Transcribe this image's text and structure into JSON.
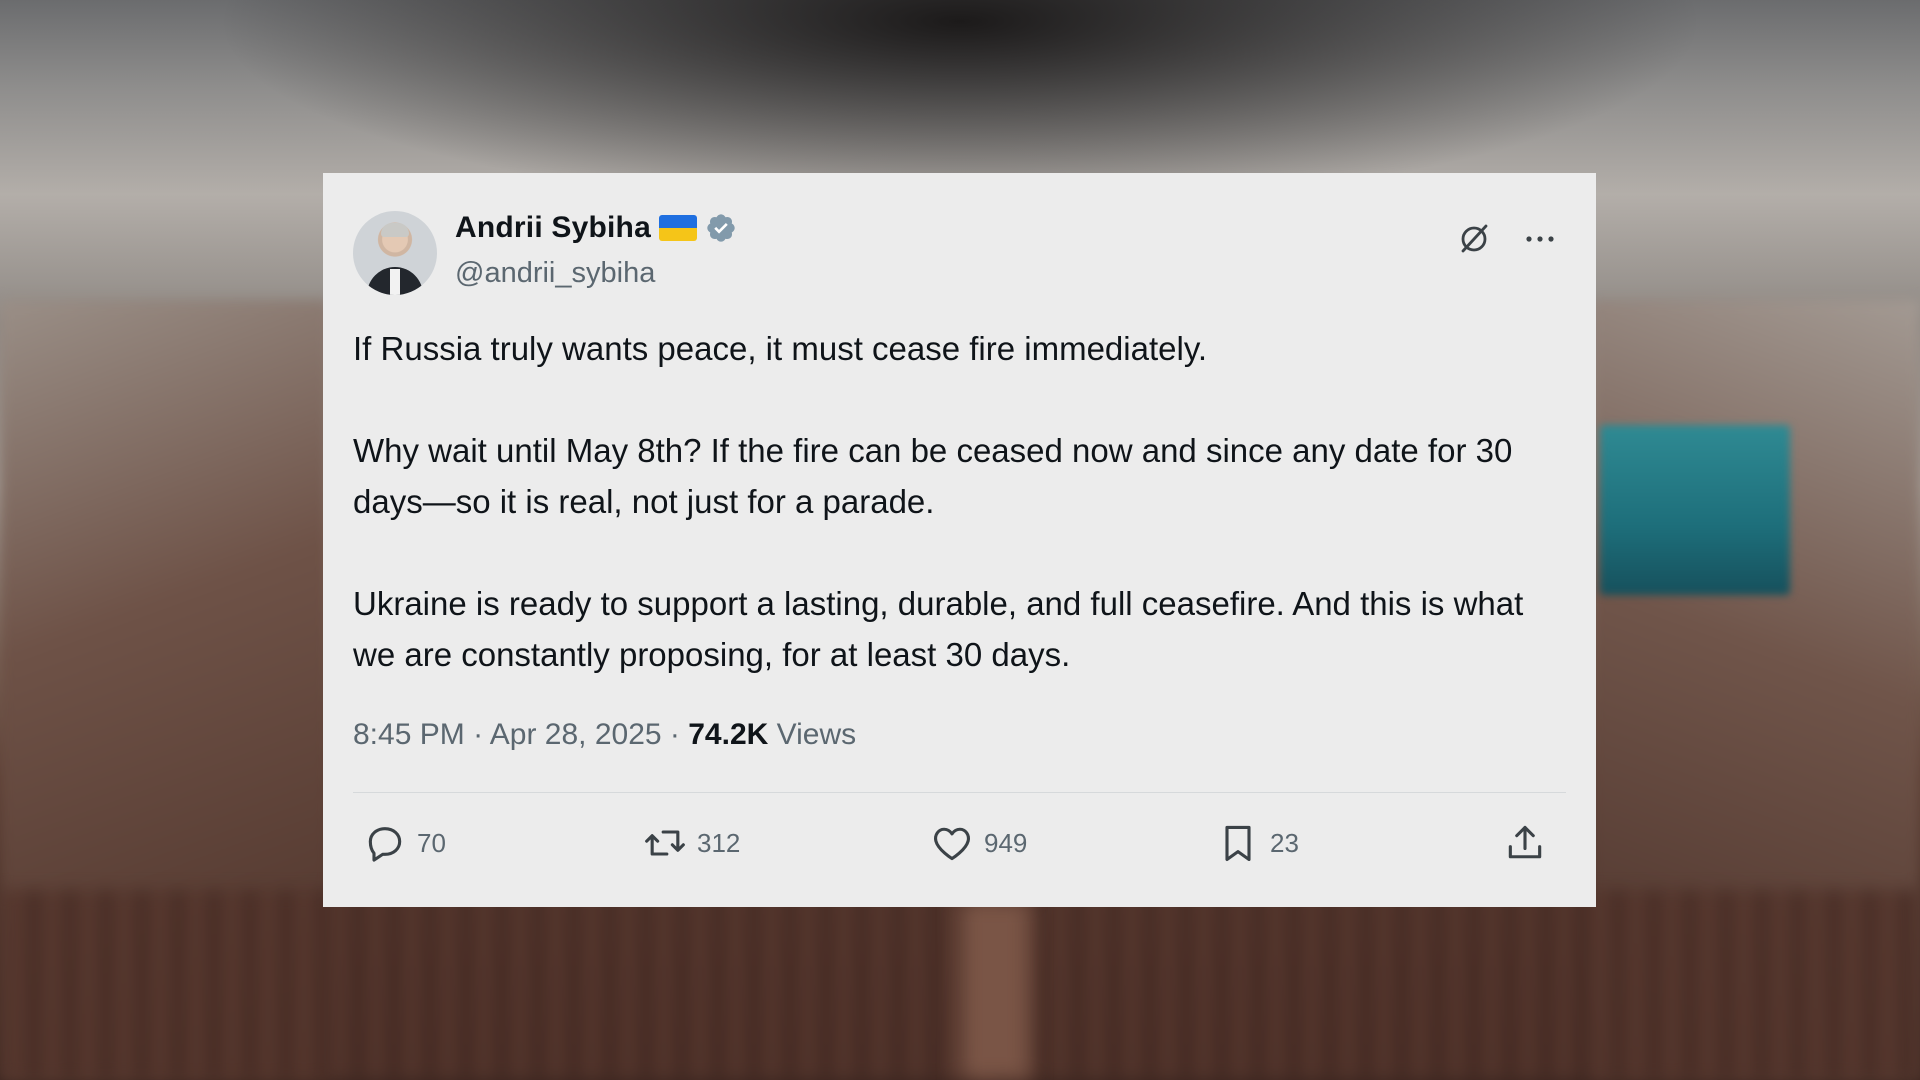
{
  "tweet": {
    "author": {
      "name": "Andrii Sybiha",
      "handle": "@andrii_sybiha",
      "flag": "ukraine-flag",
      "verified": true
    },
    "paragraphs": [
      "If Russia truly wants peace, it must cease fire immediately.",
      "Why wait until May 8th? If the fire can be ceased now and since any date for 30 days—so it is real, not just for a parade.",
      "Ukraine is ready to support a lasting, durable, and full ceasefire. And this is what we are constantly proposing, for at least 30 days."
    ],
    "meta": {
      "time": "8:45 PM",
      "date": "Apr 28, 2025",
      "separator": "·",
      "views_count": "74.2K",
      "views_label": "Views"
    },
    "actions": {
      "replies": "70",
      "reposts": "312",
      "likes": "949",
      "bookmarks": "23"
    }
  },
  "colors": {
    "card_bg": "#ececec",
    "text_primary": "#0f1419",
    "text_secondary": "#5b6770",
    "verified": "#829aab",
    "flag_blue": "#1f6fe0",
    "flag_yellow": "#f5c518"
  },
  "icons": [
    "grok-icon",
    "more-icon",
    "reply-icon",
    "repost-icon",
    "like-icon",
    "bookmark-icon",
    "share-icon",
    "verified-icon"
  ]
}
